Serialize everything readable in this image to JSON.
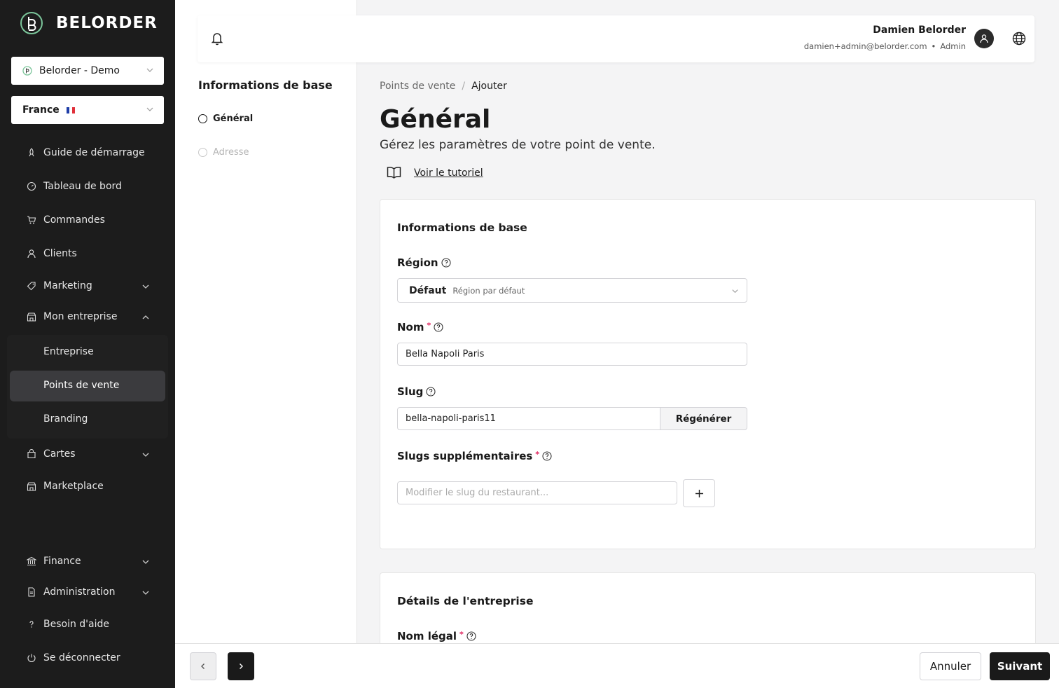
{
  "brand": {
    "name": "BELORDER"
  },
  "sidebar": {
    "workspace": "Belorder - Demo",
    "country": "France",
    "items": [
      {
        "label": "Guide de démarrage",
        "icon": "rocket-icon"
      },
      {
        "label": "Tableau de bord",
        "icon": "gauge-icon"
      },
      {
        "label": "Commandes",
        "icon": "cart-icon"
      },
      {
        "label": "Clients",
        "icon": "user-icon"
      },
      {
        "label": "Marketing",
        "icon": "tag-icon"
      },
      {
        "label": "Mon entreprise",
        "icon": "store-icon"
      },
      {
        "label": "Cartes",
        "icon": "bag-icon"
      },
      {
        "label": "Marketplace",
        "icon": "store-icon"
      },
      {
        "label": "Finance",
        "icon": "bank-icon"
      },
      {
        "label": "Administration",
        "icon": "document-icon"
      },
      {
        "label": "Besoin d'aide",
        "icon": "question-icon"
      },
      {
        "label": "Se déconnecter",
        "icon": "power-icon"
      }
    ],
    "submenu": [
      "Entreprise",
      "Points de vente",
      "Branding"
    ]
  },
  "steps": {
    "title": "Informations de base",
    "items": [
      "Général",
      "Adresse"
    ]
  },
  "topbar": {
    "user_name": "Damien Belorder",
    "user_email": "damien+admin@belorder.com",
    "separator": "•",
    "user_role": "Admin"
  },
  "breadcrumb": {
    "parent": "Points de vente",
    "separator": "/",
    "current": "Ajouter"
  },
  "page": {
    "title": "Général",
    "subtitle": "Gérez les paramètres de votre point de vente.",
    "tutorial_link": "Voir le tutoriel"
  },
  "card_basic": {
    "title": "Informations de base",
    "region_label": "Région",
    "region_value": "Défaut",
    "region_hint": "Région par défaut",
    "name_label": "Nom",
    "name_value": "Bella Napoli Paris",
    "slug_label": "Slug",
    "slug_value": "bella-napoli-paris11",
    "regenerate_label": "Régénérer",
    "extra_slugs_label": "Slugs supplémentaires",
    "extra_slug_placeholder": "Modifier le slug du restaurant..."
  },
  "card_company": {
    "title": "Détails de l'entreprise",
    "legal_name_label": "Nom légal"
  },
  "footer": {
    "cancel_label": "Annuler",
    "next_label": "Suivant"
  },
  "colors": {
    "sidebar_bg": "#1c1c1c",
    "primary": "#1a1a1a",
    "required": "#e0245e"
  }
}
